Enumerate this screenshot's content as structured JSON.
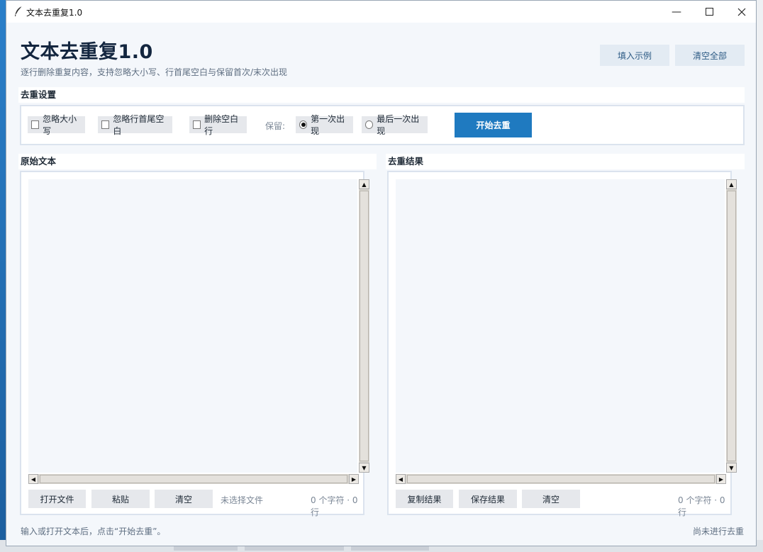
{
  "window": {
    "title": "文本去重复1.0"
  },
  "header": {
    "title": "文本去重复1.0",
    "subtitle": "逐行删除重复内容，支持忽略大小写、行首尾空白与保留首次/末次出现",
    "fill_example": "填入示例",
    "clear_all": "清空全部"
  },
  "settings": {
    "label": "去重设置",
    "ignore_case": "忽略大小写",
    "ignore_whitespace": "忽略行首尾空白",
    "remove_empty": "删除空白行",
    "keep_label": "保留:",
    "keep_first": "第一次出现",
    "keep_last": "最后一次出现",
    "keep_selected": "第一次出现",
    "start": "开始去重"
  },
  "source": {
    "label": "原始文本",
    "open_file": "打开文件",
    "paste": "粘贴",
    "clear": "清空",
    "file_status": "未选择文件",
    "count": "0 个字符 · 0 行"
  },
  "result": {
    "label": "去重结果",
    "copy": "复制结果",
    "save": "保存结果",
    "clear": "清空",
    "count": "0 个字符 · 0 行"
  },
  "status": {
    "hint": "输入或打开文本后，点击“开始去重”。",
    "state": "尚未进行去重"
  },
  "colors": {
    "accent": "#1f7ac0",
    "panel_border": "#dbe3ee",
    "background": "#f4f7fb"
  }
}
